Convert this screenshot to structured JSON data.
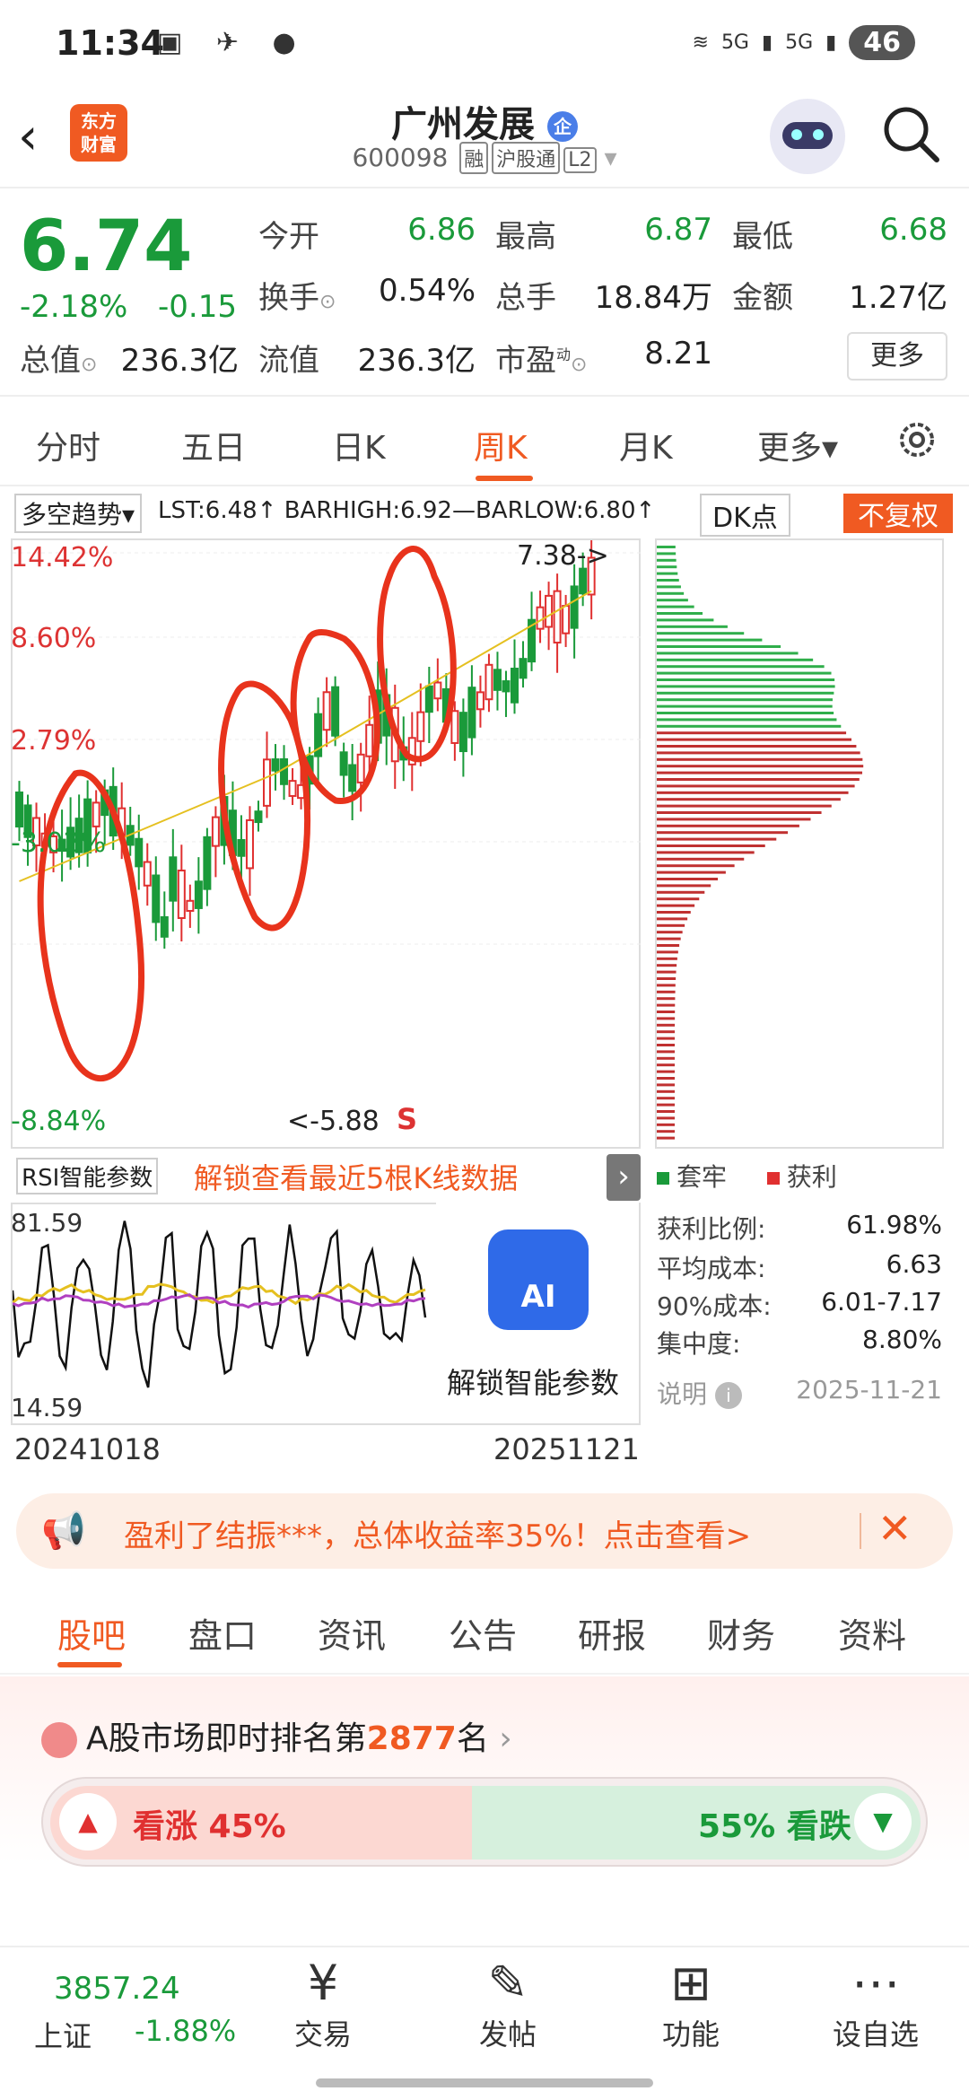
{
  "status": {
    "time": "11:34",
    "battery": "46",
    "net1": "5G",
    "net2": "5G"
  },
  "header": {
    "title": "广州发展",
    "badge": "企",
    "code": "600098",
    "tags": [
      "融",
      "沪股通",
      "L2"
    ],
    "logo": "东方\n财富"
  },
  "quote": {
    "price": "6.74",
    "pct": "-2.18%",
    "change": "-0.15",
    "open_l": "今开",
    "open_v": "6.86",
    "high_l": "最高",
    "high_v": "6.87",
    "low_l": "最低",
    "low_v": "6.68",
    "turn_l": "换手",
    "turn_v": "0.54%",
    "vol_l": "总手",
    "vol_v": "18.84万",
    "amt_l": "金额",
    "amt_v": "1.27亿",
    "cap_l": "总值",
    "cap_v": "236.3亿",
    "flt_l": "流值",
    "flt_v": "236.3亿",
    "pe_l": "市盈",
    "pe_sup": "动",
    "pe_v": "8.21",
    "more": "更多"
  },
  "tabs": [
    "分时",
    "五日",
    "日K",
    "周K",
    "月K",
    "更多▾"
  ],
  "chart_bar": {
    "selector": "多空趋势▾",
    "indicator": "LST:6.48↑ BARHIGH:6.92—BARLOW:6.80↑",
    "dk": "DK点",
    "fq": "不复权"
  },
  "kline": {
    "y_labels": [
      "14.42%",
      "8.60%",
      "2.79%",
      "-3.02%",
      "-8.84%"
    ],
    "max_label": "7.38->",
    "min_label": "<-5.88",
    "signal": "S"
  },
  "rsi": {
    "label": "RSI智能参数",
    "unlock": "解锁查看最近5根K线数据",
    "top": "81.59",
    "bottom": "14.59",
    "ai": "AI",
    "ai_text": "解锁智能参数"
  },
  "dates": {
    "start": "20241018",
    "end": "20251121"
  },
  "chip": {
    "legend_trap": "套牢",
    "legend_profit": "获利",
    "stats": [
      {
        "label": "获利比例:",
        "value": "61.98%"
      },
      {
        "label": "平均成本:",
        "value": "6.63"
      },
      {
        "label": "90%成本:",
        "value": "6.01-7.17"
      },
      {
        "label": "集中度:",
        "value": "8.80%"
      }
    ],
    "note": "说明",
    "date": "2025-11-21"
  },
  "promo": {
    "text": "盈利了结振***，总体收益率35%！点击查看>"
  },
  "tabs2": [
    "股吧",
    "盘口",
    "资讯",
    "公告",
    "研报",
    "财务",
    "资料"
  ],
  "rank": {
    "prefix": "A股市场即时排名第",
    "num": "2877",
    "suffix": "名"
  },
  "vote": {
    "up": "看涨 45%",
    "down": "55% 看跌"
  },
  "index": {
    "value": "3857.24",
    "name": "上证",
    "change": "-1.88%"
  },
  "nav": [
    "交易",
    "发帖",
    "功能",
    "设自选"
  ],
  "colors": {
    "accent": "#f05a22",
    "up": "#e03030",
    "down": "#1a9a3a"
  }
}
